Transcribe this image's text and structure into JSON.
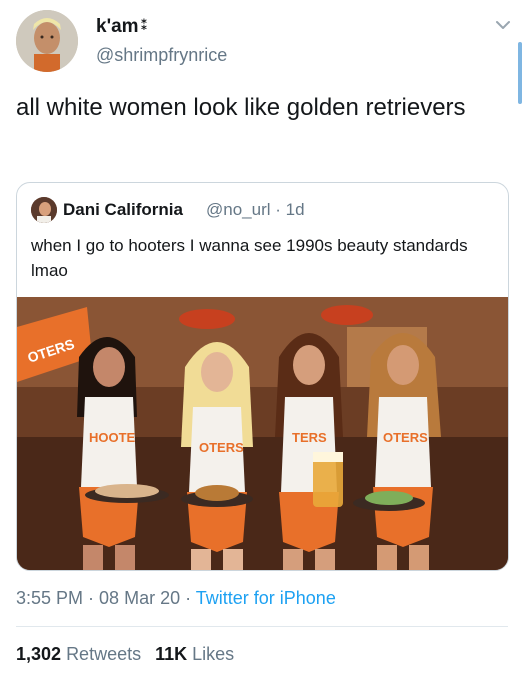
{
  "tweet": {
    "author_name": "k'am",
    "author_badge": "⁑",
    "author_handle": "@shrimpfrynrice",
    "text": "all white women look like golden retrievers",
    "timestamp_time": "3:55 PM",
    "timestamp_sep1": " · ",
    "timestamp_date": "08 Mar 20",
    "timestamp_sep2": " · ",
    "source": "Twitter for iPhone"
  },
  "quoted": {
    "author_name": "Dani California",
    "author_handle": "@no_url",
    "time_ago": "1d",
    "meta_sep": " · ",
    "text": "when I go to hooters I wanna see 1990s beauty standards lmao",
    "photo_shirt_text": [
      "HOOTE",
      "OTERS",
      "TERS",
      "OTERS"
    ],
    "photo_sign_text": "OTERS"
  },
  "stats": {
    "retweets_count": "1,302",
    "retweets_label": "Retweets",
    "likes_count": "11K",
    "likes_label": "Likes"
  },
  "icons": {
    "menu": "chevron-down-icon"
  }
}
